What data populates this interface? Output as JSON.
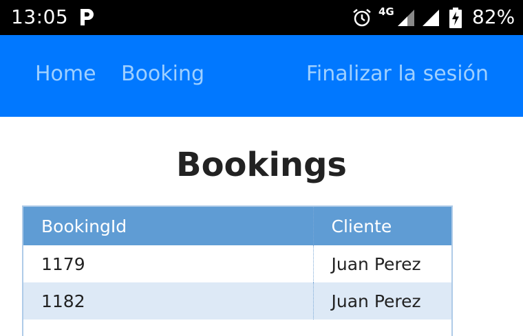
{
  "status_bar": {
    "time": "13:05",
    "app_icon": "p-icon",
    "network": "4G",
    "battery": "82%"
  },
  "nav": {
    "home": "Home",
    "booking": "Booking",
    "logout": "Finalizar la sesión"
  },
  "page": {
    "title": "Bookings"
  },
  "table": {
    "headers": [
      "BookingId",
      "Cliente"
    ],
    "rows": [
      [
        "1179",
        "Juan Perez"
      ],
      [
        "1182",
        "Juan Perez"
      ]
    ]
  },
  "colors": {
    "nav_bg": "#0178ff",
    "nav_link": "#9fd0ff",
    "table_header": "#5f9cd4",
    "row_alt": "#dde9f6"
  }
}
